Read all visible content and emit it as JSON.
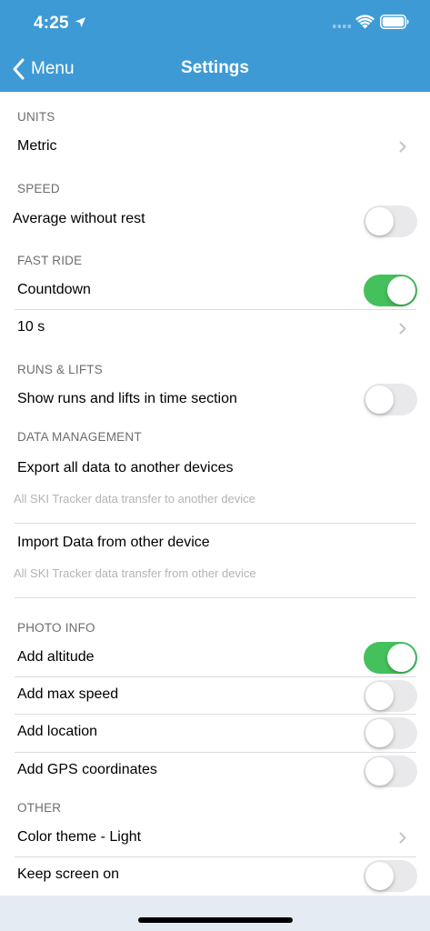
{
  "status_bar": {
    "time": "4:25"
  },
  "nav": {
    "back_label": "Menu",
    "title": "Settings"
  },
  "colors": {
    "header": "#3d9ad5",
    "toggle_on": "#44c15c",
    "toggle_off": "#e9e9eb"
  },
  "sections": {
    "units": {
      "header": "UNITS",
      "metric": {
        "label": "Metric",
        "icon": "chevron-right"
      }
    },
    "speed": {
      "header": "SPEED",
      "average": {
        "label": "Average without rest",
        "on": false
      }
    },
    "fast_ride": {
      "header": "FAST RIDE",
      "countdown": {
        "label": "Countdown",
        "on": true
      },
      "seconds": {
        "label": "10 s",
        "icon": "chevron-right"
      }
    },
    "runs_lifts": {
      "header": "RUNS & LIFTS",
      "show": {
        "label": "Show runs and lifts in time section",
        "on": false
      }
    },
    "data_management": {
      "header": "DATA MANAGEMENT",
      "export": {
        "label": "Export all data to another devices",
        "sub": "All SKI Tracker data transfer to another device"
      },
      "import": {
        "label": "Import Data from other device",
        "sub": "All SKI Tracker data transfer from other device"
      }
    },
    "photo_info": {
      "header": "PHOTO INFO",
      "altitude": {
        "label": "Add altitude",
        "on": true
      },
      "max_speed": {
        "label": "Add max speed",
        "on": false
      },
      "location": {
        "label": "Add location",
        "on": false
      },
      "gps": {
        "label": "Add GPS coordinates",
        "on": false
      }
    },
    "other": {
      "header": "OTHER",
      "theme": {
        "label": "Color theme - Light",
        "icon": "chevron-right"
      },
      "screen_on": {
        "label": "Keep screen on",
        "on": false
      }
    }
  }
}
